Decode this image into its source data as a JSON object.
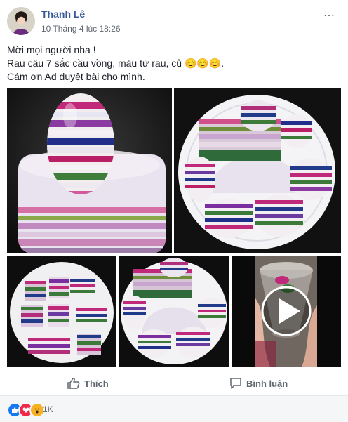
{
  "post": {
    "author": "Thanh Lê",
    "timestamp": "10 Tháng 4 lúc 18:26",
    "more_icon": "⋯",
    "text_lines": [
      "Mời mọi người nha !",
      "Rau câu 7 sắc cầu vồng, màu từ rau, củ 😊😊😊.",
      "Cám ơn Ad duyệt bài cho mình."
    ]
  },
  "actions": {
    "like_label": "Thích",
    "comment_label": "Bình luận"
  },
  "reactions": {
    "count": "1K",
    "icons": [
      "like-icon",
      "love-icon",
      "wow-icon"
    ]
  },
  "colors": {
    "link": "#385898",
    "like": "#1877f2",
    "love": "#f0284a",
    "wow": "#f7b125"
  }
}
